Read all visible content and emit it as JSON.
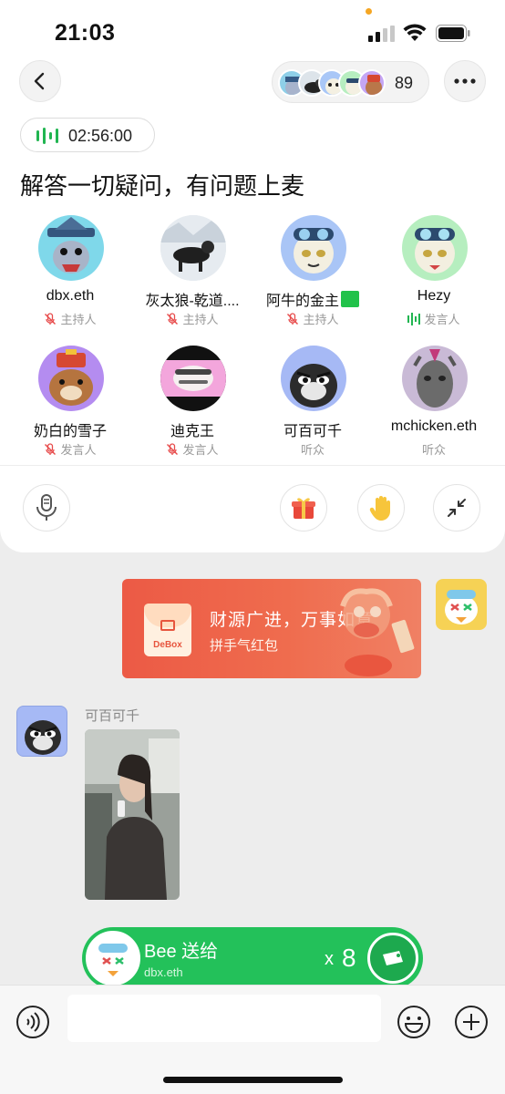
{
  "status_bar": {
    "time": "21:03"
  },
  "header": {
    "listener_count": "89"
  },
  "room": {
    "timer": "02:56:00",
    "title": "解答一切疑问，有问题上麦"
  },
  "speakers": [
    {
      "name": "dbx.eth",
      "role": "主持人",
      "muted": true
    },
    {
      "name": "灰太狼-乾道....",
      "role": "主持人",
      "muted": true
    },
    {
      "name": "阿牛的金主",
      "role": "主持人",
      "muted": true,
      "badge": "green-square"
    },
    {
      "name": "Hezy",
      "role": "发言人",
      "muted": false,
      "speaking": true
    },
    {
      "name": "奶白的雪子",
      "role": "发言人",
      "muted": true
    },
    {
      "name": "迪克王",
      "role": "发言人",
      "muted": true
    },
    {
      "name": "可百可千",
      "role": "听众",
      "muted": false
    },
    {
      "name": "mchicken.eth",
      "role": "听众",
      "muted": false
    }
  ],
  "red_packet": {
    "brand": "DeBox",
    "title": "财源广进，万事如意",
    "subtitle": "拼手气红包"
  },
  "message": {
    "sender": "可百可千"
  },
  "gift": {
    "sender": "Bee 送给",
    "receiver": "dbx.eth",
    "x": "x",
    "count": "8"
  },
  "input": {
    "placeholder": ""
  },
  "colors": {
    "accent_green": "#23c15a",
    "red_packet": "#ec5a45",
    "mute_red": "#e74a4a"
  }
}
